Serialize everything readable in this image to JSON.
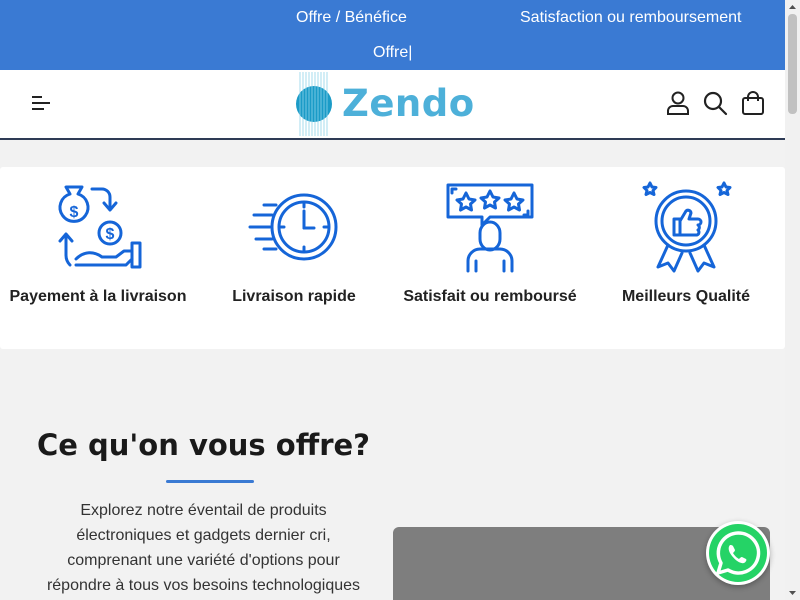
{
  "topbar": {
    "offer_link": "Offre / Bénéfice",
    "guarantee_link": "Satisfaction ou remboursement",
    "offer_text": "Offre|"
  },
  "header": {
    "logo_text": "Zendo",
    "icons": [
      "menu-icon",
      "user-icon",
      "search-icon",
      "cart-bag-icon"
    ]
  },
  "features": [
    {
      "icon": "money-exchange-icon",
      "label": "Payement à la livraison"
    },
    {
      "icon": "fast-clock-icon",
      "label": "Livraison rapide"
    },
    {
      "icon": "rating-person-icon",
      "label": "Satisfait ou remboursé"
    },
    {
      "icon": "quality-badge-icon",
      "label": "Meilleurs Qualité"
    }
  ],
  "offer": {
    "title": "Ce qu'on vous offre?",
    "description": "Explorez notre éventail de produits électroniques et gadgets dernier cri, comprenant une variété d'options pour répondre à tous vos besoins technologiques"
  },
  "colors": {
    "primary_blue": "#3a7ad3",
    "icon_blue": "#1565d8",
    "logo_blue": "#4db0d9",
    "whatsapp_green": "#25d366"
  },
  "floating": {
    "whatsapp_icon": "whatsapp-icon"
  }
}
